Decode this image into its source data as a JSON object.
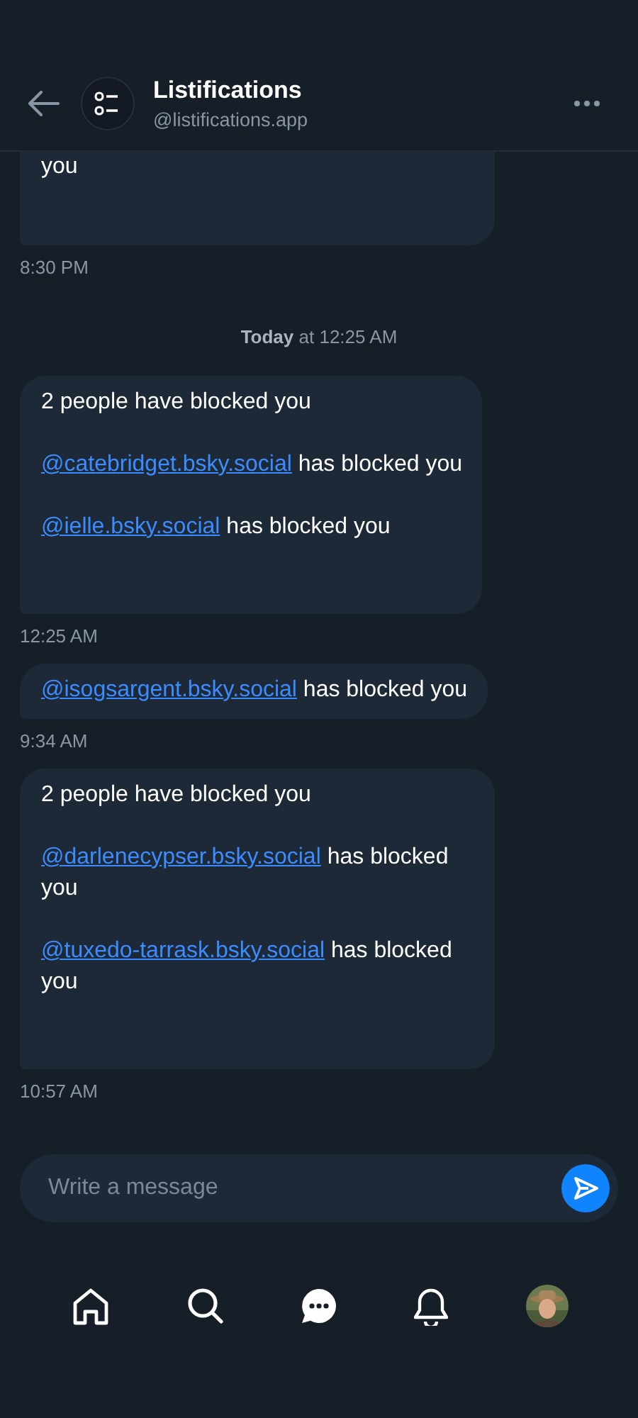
{
  "header": {
    "title": "Listifications",
    "handle": "@listifications.app"
  },
  "items": [
    {
      "kind": "message",
      "paragraphs": [
        [
          {
            "kind": "text",
            "text": "you"
          }
        ]
      ],
      "time": "8:30 PM"
    },
    {
      "kind": "date",
      "text": "**Today** at 12:25 AM"
    },
    {
      "kind": "message",
      "paragraphs": [
        [
          {
            "kind": "text",
            "text": "2 people have blocked you"
          }
        ],
        [
          {
            "kind": "link",
            "text": "@catebridget.bsky.social"
          },
          {
            "kind": "text",
            "text": " has blocked you"
          }
        ],
        [
          {
            "kind": "link",
            "text": "@ielle.bsky.social"
          },
          {
            "kind": "text",
            "text": " has blocked you"
          }
        ]
      ],
      "time": "12:25 AM"
    },
    {
      "kind": "message",
      "paragraphs": [
        [
          {
            "kind": "link",
            "text": "@isogsargent.bsky.social"
          },
          {
            "kind": "text",
            "text": " has blocked you"
          }
        ]
      ],
      "time": "9:34 AM"
    },
    {
      "kind": "message",
      "paragraphs": [
        [
          {
            "kind": "text",
            "text": "2 people have blocked you"
          }
        ],
        [
          {
            "kind": "link",
            "text": "@darlenecypser.bsky.social"
          },
          {
            "kind": "text",
            "text": " has blocked you"
          }
        ],
        [
          {
            "kind": "link",
            "text": "@tuxedo-tarrask.bsky.social"
          },
          {
            "kind": "text",
            "text": " has blocked you"
          }
        ]
      ],
      "time": "10:57 AM"
    }
  ],
  "composer": {
    "placeholder": "Write a message"
  }
}
